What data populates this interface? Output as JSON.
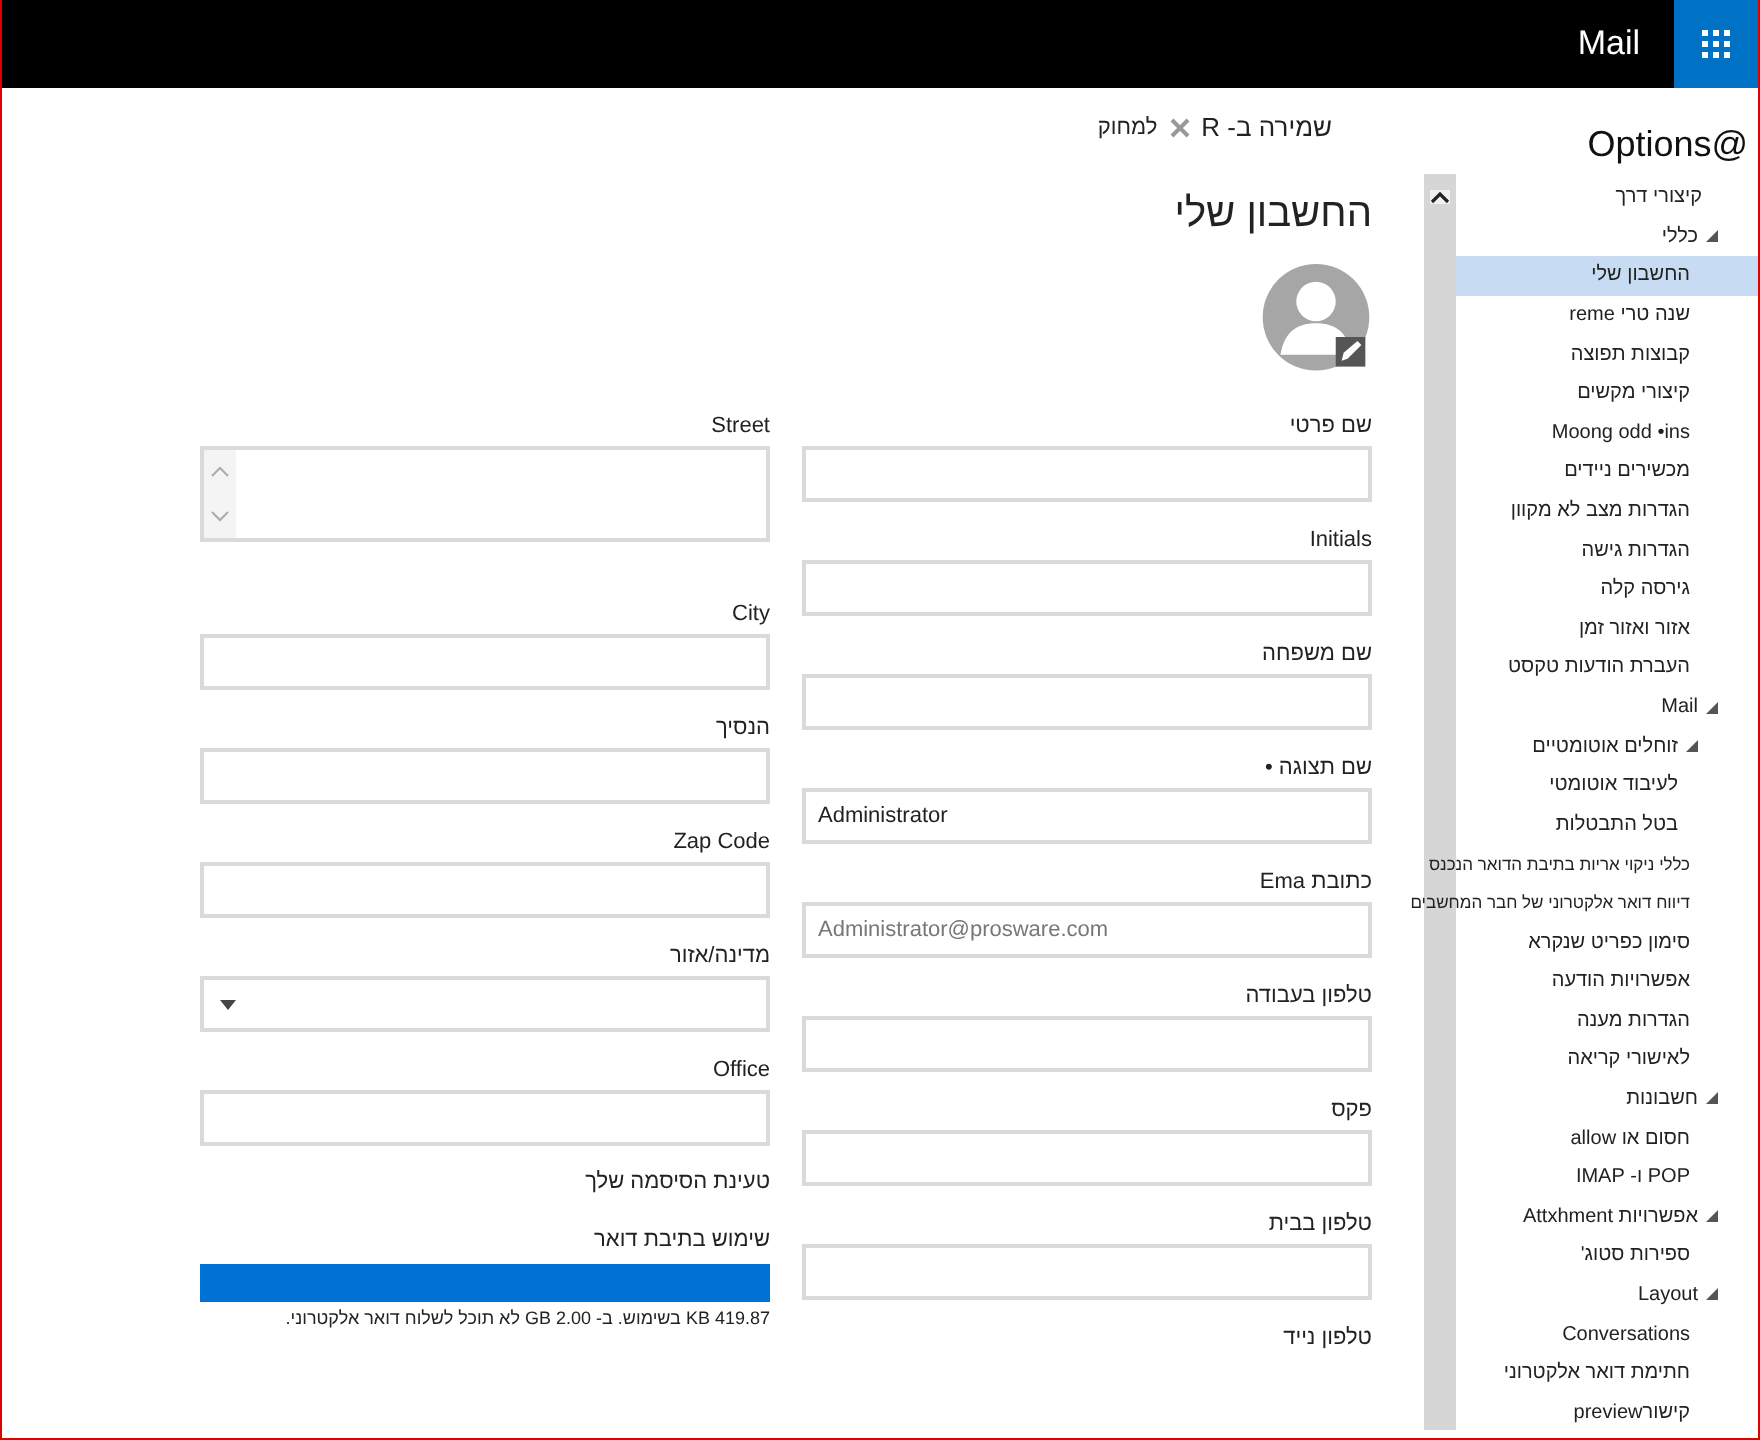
{
  "top_bar": {
    "title": "Mail"
  },
  "sidebar": {
    "title": "Options@",
    "items": [
      {
        "label": "קיצורי דרך",
        "selected": false
      },
      {
        "label": "כללי",
        "selected": false,
        "expanded": true,
        "children": [
          {
            "label": "החשבון שלי",
            "selected": true
          },
          {
            "label": "שנה טרי reme",
            "selected": false
          },
          {
            "label": "קבוצות תפוצה",
            "selected": false
          },
          {
            "label": "קיצורי מקשים",
            "selected": false
          },
          {
            "label": "Moong odd •ins",
            "selected": false
          },
          {
            "label": "מכשירים ניידים",
            "selected": false
          },
          {
            "label": "הגדרות מצב לא מקוון",
            "selected": false
          },
          {
            "label": "הגדרות גישה",
            "selected": false
          },
          {
            "label": "גירסה קלה",
            "selected": false
          },
          {
            "label": "אזור ואזור זמן",
            "selected": false
          },
          {
            "label": "העברת הודעות טקסט",
            "selected": false
          }
        ]
      },
      {
        "label": "Mail",
        "selected": false,
        "expanded": true,
        "children": [
          {
            "label": "זוחלים אוטומטיים",
            "selected": false,
            "expanded": true,
            "children": [
              {
                "label": "לעיבוד אוטומטי",
                "selected": false
              },
              {
                "label": "בטל התבטלות",
                "selected": false
              }
            ]
          },
          {
            "label": "כללי ניקוי אריות בתיבת הדואר הנכנס",
            "selected": false
          },
          {
            "label": "דיווח דואר אלקטרוני של חבר המחשבים",
            "selected": false
          },
          {
            "label": "סימון כפריט שנקרא",
            "selected": false
          },
          {
            "label": "אפשרויות הודעה",
            "selected": false
          },
          {
            "label": "הגדרות מענה",
            "selected": false
          },
          {
            "label": "לאישורי קריאה",
            "selected": false
          }
        ]
      },
      {
        "label": "חשבונות",
        "selected": false,
        "expanded": true,
        "children": [
          {
            "label": "חסום או allow",
            "selected": false
          },
          {
            "label": "POP ו- IMAP",
            "selected": false
          }
        ]
      },
      {
        "label": "אפשרויות Attxhment",
        "selected": false,
        "expanded": true,
        "children": [
          {
            "label": "ספירות סטוג'",
            "selected": false
          }
        ]
      },
      {
        "label": "Layout",
        "selected": false,
        "expanded": true,
        "children": [
          {
            "label": "Conversations",
            "selected": false
          },
          {
            "label": "חתימת דואר אלקטרוני",
            "selected": false
          },
          {
            "label": "קישורpreview",
            "selected": false
          }
        ]
      }
    ]
  },
  "toolbar": {
    "save": "שמירה ב- R",
    "discard": "למחוק"
  },
  "page_title": "החשבון שלי",
  "right_column": [
    {
      "label": "שם פרטי",
      "kind": "text"
    },
    {
      "label": "Initials",
      "kind": "text"
    },
    {
      "label": "שם משפחה",
      "kind": "text"
    },
    {
      "label": "שם תצוגה •",
      "kind": "text",
      "value": "Administrator"
    },
    {
      "label": "כתובת Ema",
      "kind": "readonly",
      "value": "Administrator@prosware.com"
    },
    {
      "label": "טלפון בעבודה",
      "kind": "text"
    },
    {
      "label": "פקס",
      "kind": "text"
    },
    {
      "label": "טלפון בבית",
      "kind": "text"
    },
    {
      "label": "טלפון נייד",
      "kind": "label"
    }
  ],
  "left_column": [
    {
      "label": "Street",
      "kind": "textarea"
    },
    {
      "label": "City",
      "kind": "text"
    },
    {
      "label": "הנסיך",
      "kind": "text"
    },
    {
      "label": "Zap Code",
      "kind": "text"
    },
    {
      "label": "מדינה/אזור",
      "kind": "dropdown"
    },
    {
      "label": "Office",
      "kind": "text"
    }
  ],
  "password_link": "טעינת הסיסמה שלך",
  "mailbox_usage": {
    "label": "שימוש בתיבת דואר",
    "level": 1,
    "note": "419.87 KB בשימוש. ב- 2.00 GB לא תוכל לשלוח דואר אלקטרוני."
  }
}
